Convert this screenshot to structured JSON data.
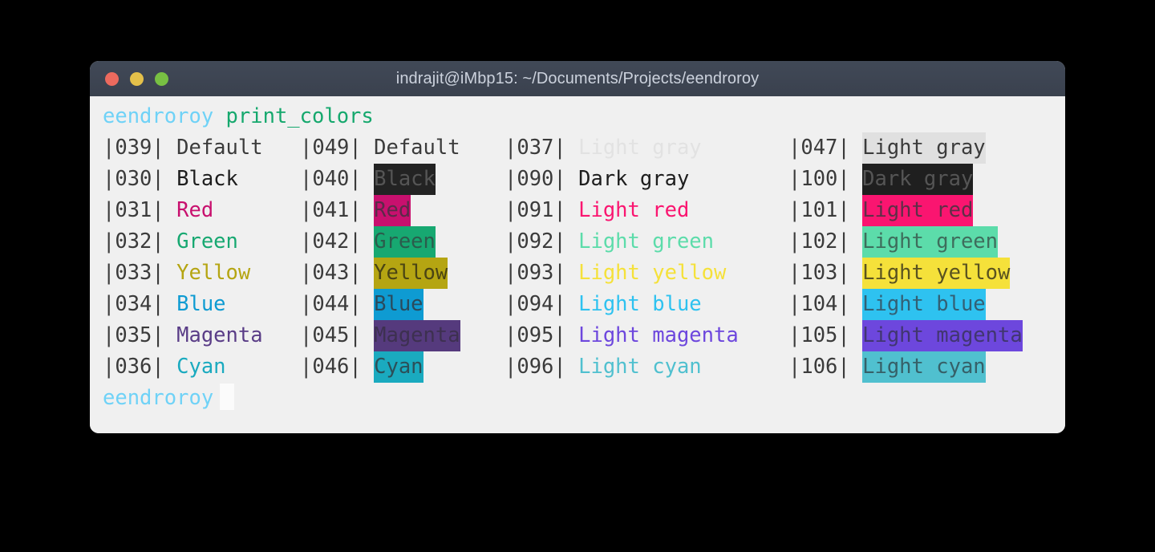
{
  "window": {
    "title": "indrajit@iMbp15: ~/Documents/Projects/eendroroy",
    "buttons": {
      "close": "close",
      "minimize": "minimize",
      "maximize": "maximize"
    },
    "titlebar_bg": "#3d4450",
    "body_bg": "#f0f0f0"
  },
  "terminal": {
    "prompt_1": "eendroroy",
    "command_1": "print_colors",
    "prompt_2": "eendroroy",
    "cursor": "█",
    "prompt_color": "#6fd2f7",
    "command_color": "#15a86d",
    "code_color": "#3b3b3b",
    "cursor_color": "#fbfbfb"
  },
  "columns": [
    {
      "name": "foreground-normal",
      "rows": [
        {
          "code": "|039|",
          "label": "Default",
          "fg": "#3b3b3b",
          "bg": "transparent"
        },
        {
          "code": "|030|",
          "label": "Black",
          "fg": "#1d1d1d",
          "bg": "transparent"
        },
        {
          "code": "|031|",
          "label": "Red",
          "fg": "#c8106e",
          "bg": "transparent"
        },
        {
          "code": "|032|",
          "label": "Green",
          "fg": "#17a871",
          "bg": "transparent"
        },
        {
          "code": "|033|",
          "label": "Yellow",
          "fg": "#b5a512",
          "bg": "transparent"
        },
        {
          "code": "|034|",
          "label": "Blue",
          "fg": "#0e9bd2",
          "bg": "transparent"
        },
        {
          "code": "|035|",
          "label": "Magenta",
          "fg": "#5a3d87",
          "bg": "transparent"
        },
        {
          "code": "|036|",
          "label": "Cyan",
          "fg": "#1aaabf",
          "bg": "transparent"
        }
      ]
    },
    {
      "name": "background-normal",
      "rows": [
        {
          "code": "|049|",
          "label": "Default",
          "fg": "#3b3b3b",
          "bg": "transparent"
        },
        {
          "code": "|040|",
          "label": "Black",
          "fg": "#555555",
          "bg": "#232323"
        },
        {
          "code": "|041|",
          "label": "Red",
          "fg": "#5a2a48",
          "bg": "#c8106e"
        },
        {
          "code": "|042|",
          "label": "Green",
          "fg": "#2b5c4c",
          "bg": "#17a871"
        },
        {
          "code": "|043|",
          "label": "Yellow",
          "fg": "#4a4414",
          "bg": "#b5a512"
        },
        {
          "code": "|044|",
          "label": "Blue",
          "fg": "#2a4a5c",
          "bg": "#0e9bd2"
        },
        {
          "code": "|045|",
          "label": "Magenta",
          "fg": "#3d3050",
          "bg": "#553a7d"
        },
        {
          "code": "|046|",
          "label": "Cyan",
          "fg": "#2c4f58",
          "bg": "#1aaabf"
        }
      ]
    },
    {
      "name": "foreground-bright",
      "rows": [
        {
          "code": "|037|",
          "label": "Light gray",
          "fg": "#e2e2e2",
          "bg": "transparent"
        },
        {
          "code": "|090|",
          "label": "Dark gray",
          "fg": "#1d1d1d",
          "bg": "transparent"
        },
        {
          "code": "|091|",
          "label": "Light red",
          "fg": "#fa1570",
          "bg": "transparent"
        },
        {
          "code": "|092|",
          "label": "Light green",
          "fg": "#5cdcaa",
          "bg": "transparent"
        },
        {
          "code": "|093|",
          "label": "Light yellow",
          "fg": "#f5e13a",
          "bg": "transparent"
        },
        {
          "code": "|094|",
          "label": "Light blue",
          "fg": "#2ec2f0",
          "bg": "transparent"
        },
        {
          "code": "|095|",
          "label": "Light magenta",
          "fg": "#6d47dd",
          "bg": "transparent"
        },
        {
          "code": "|096|",
          "label": "Light cyan",
          "fg": "#50c0cf",
          "bg": "transparent"
        }
      ]
    },
    {
      "name": "background-bright",
      "rows": [
        {
          "code": "|047|",
          "label": "Light gray",
          "fg": "#3b3b3b",
          "bg": "#e0e0e0"
        },
        {
          "code": "|100|",
          "label": "Dark gray",
          "fg": "#555555",
          "bg": "#1f1f1f"
        },
        {
          "code": "|101|",
          "label": "Light red",
          "fg": "#5e2f47",
          "bg": "#fa1570"
        },
        {
          "code": "|102|",
          "label": "Light green",
          "fg": "#3e6d5c",
          "bg": "#5cdcaa"
        },
        {
          "code": "|103|",
          "label": "Light yellow",
          "fg": "#5a5320",
          "bg": "#f5e13a"
        },
        {
          "code": "|104|",
          "label": "Light blue",
          "fg": "#336075",
          "bg": "#2ec2f0"
        },
        {
          "code": "|105|",
          "label": "Light magenta",
          "fg": "#413670",
          "bg": "#6d47dd"
        },
        {
          "code": "|106|",
          "label": "Light cyan",
          "fg": "#366068",
          "bg": "#50c0cf"
        }
      ]
    }
  ]
}
